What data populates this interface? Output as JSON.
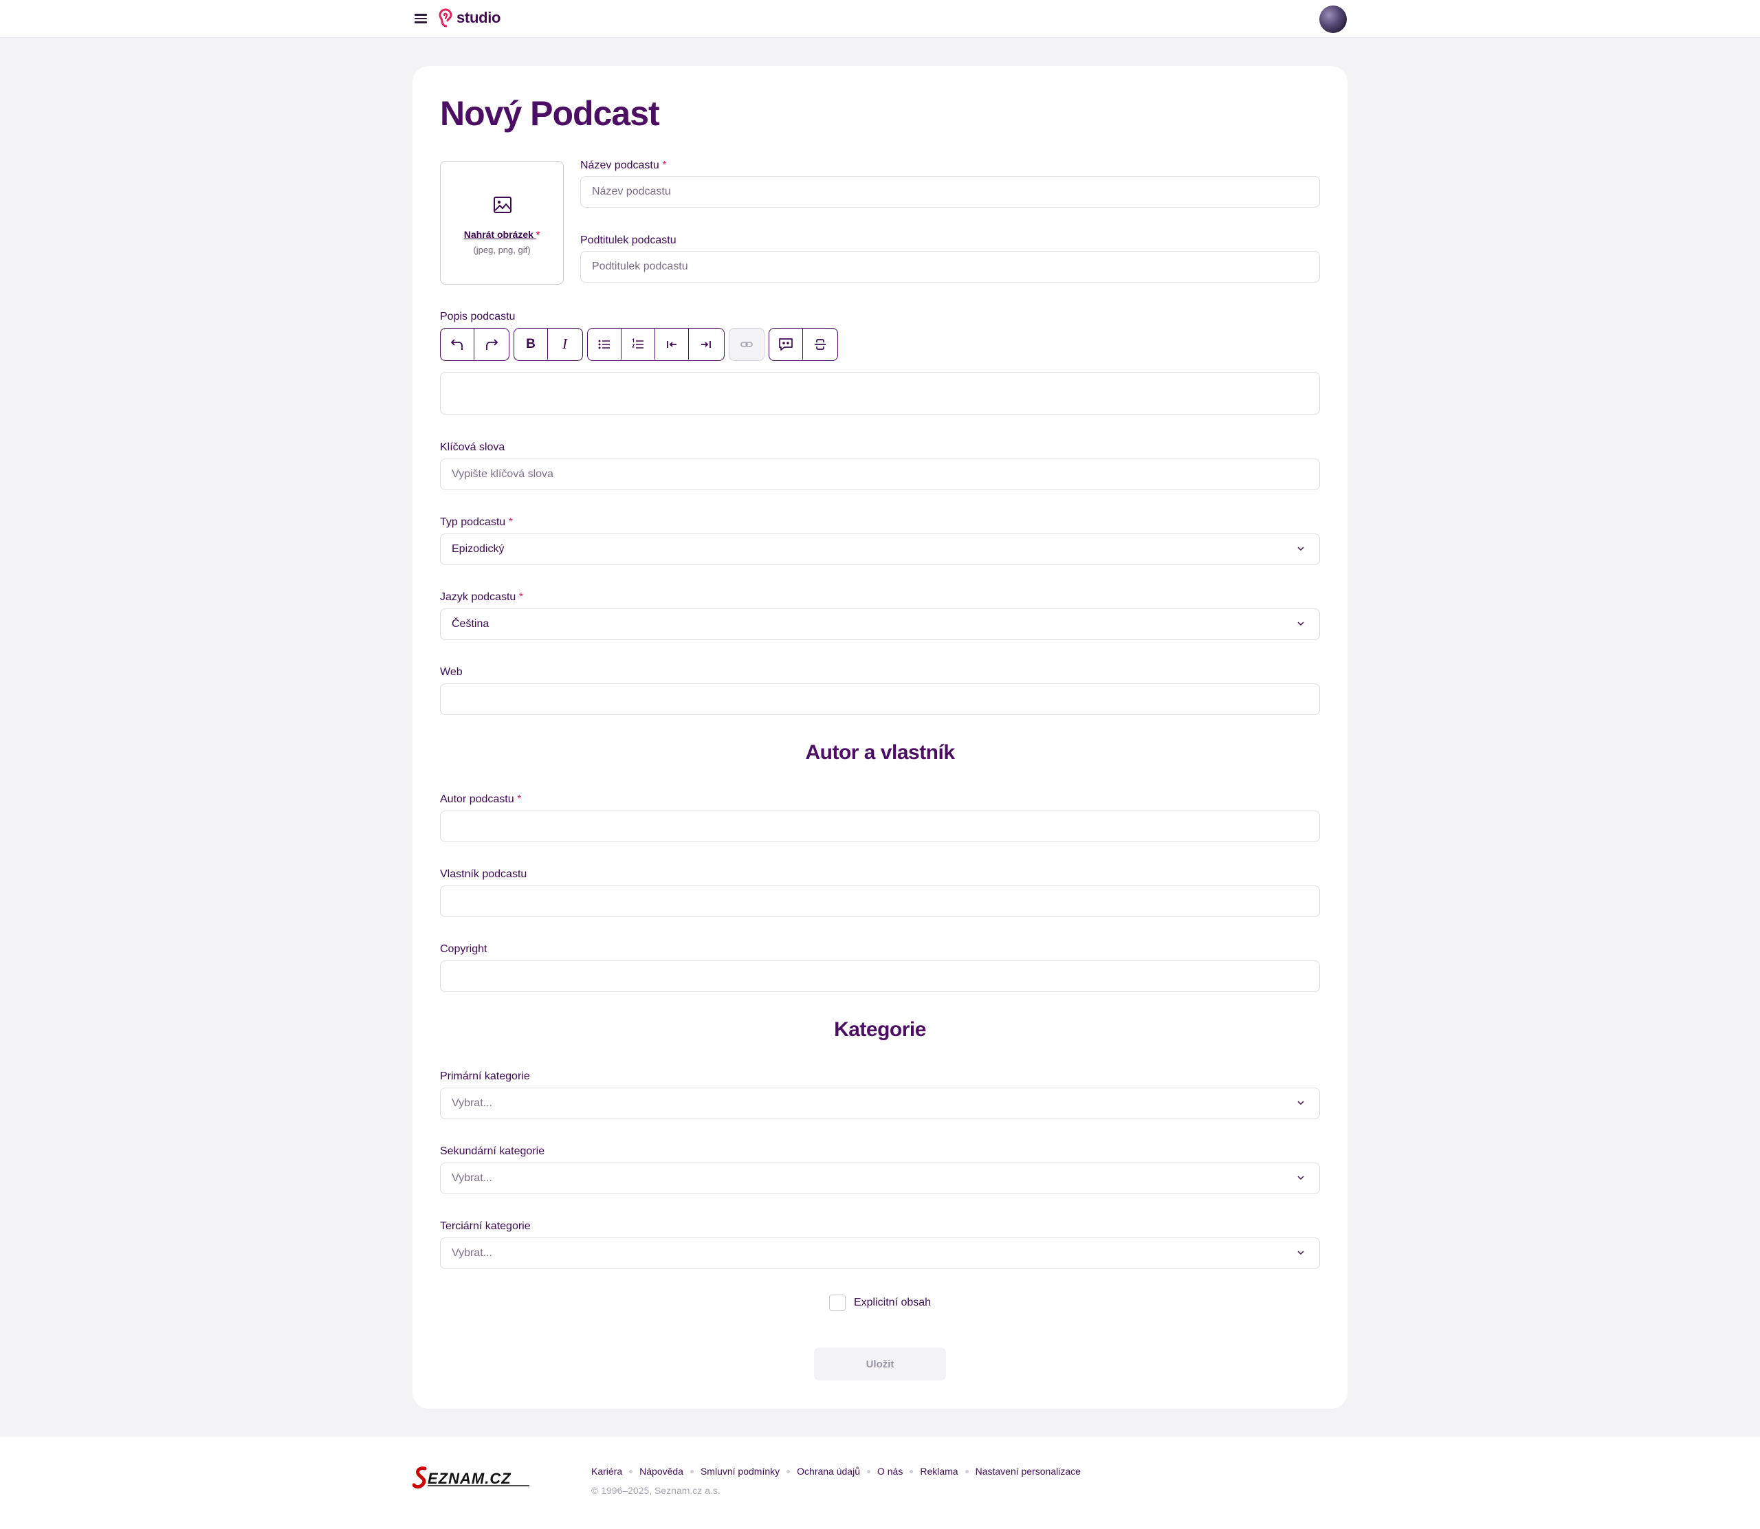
{
  "header": {
    "logo_text": "studio",
    "brand_color": "#e0245e",
    "menu_icon": "hamburger-icon",
    "avatar_icon": "user-avatar"
  },
  "page": {
    "title": "Nový Podcast"
  },
  "upload": {
    "link": "Nahrát obrázek",
    "required_mark": "*",
    "hint": "(jpeg, png, gif)",
    "icon": "image-icon"
  },
  "fields": {
    "name": {
      "label": "Název podcastu",
      "required": "*",
      "placeholder": "Název podcastu"
    },
    "subtitle": {
      "label": "Podtitulek podcastu",
      "placeholder": "Podtitulek podcastu"
    },
    "description": {
      "label": "Popis podcastu"
    },
    "keywords": {
      "label": "Klíčová slova",
      "placeholder": "Vypište klíčová slova"
    },
    "type": {
      "label": "Typ podcastu",
      "required": "*",
      "value": "Epizodický"
    },
    "language": {
      "label": "Jazyk podcastu",
      "required": "*",
      "value": "Čeština"
    },
    "web": {
      "label": "Web",
      "value": ""
    },
    "author": {
      "label": "Autor podcastu",
      "required": "*",
      "value": ""
    },
    "owner": {
      "label": "Vlastník podcastu",
      "value": ""
    },
    "copyright": {
      "label": "Copyright",
      "value": ""
    },
    "primary_category": {
      "label": "Primární kategorie",
      "placeholder": "Vybrat..."
    },
    "secondary_category": {
      "label": "Sekundární kategorie",
      "placeholder": "Vybrat..."
    },
    "tertiary_category": {
      "label": "Terciární kategorie",
      "placeholder": "Vybrat..."
    }
  },
  "toolbar": {
    "buttons": [
      "undo-icon",
      "redo-icon",
      "bold-icon",
      "italic-icon",
      "bullet-list-icon",
      "numbered-list-icon",
      "outdent-icon",
      "indent-icon",
      "link-icon",
      "blockquote-icon",
      "strikethrough-icon"
    ],
    "bold_glyph": "B",
    "italic_glyph": "I"
  },
  "sections": {
    "author_owner": "Autor a vlastník",
    "categories": "Kategorie"
  },
  "explicit": {
    "label": "Explicitní obsah",
    "checked": false
  },
  "save": {
    "label": "Uložit"
  },
  "footer": {
    "logo_text": "Seznam.cz",
    "links": [
      "Kariéra",
      "Nápověda",
      "Smluvní podmínky",
      "Ochrana údajů",
      "O nás",
      "Reklama",
      "Nastavení personalizace"
    ],
    "copyright": "© 1996–2025, Seznam.cz a.s."
  },
  "colors": {
    "primary": "#4b0e63",
    "text": "#3d0a52",
    "required": "#e0245e",
    "background": "#f3f3f5"
  }
}
